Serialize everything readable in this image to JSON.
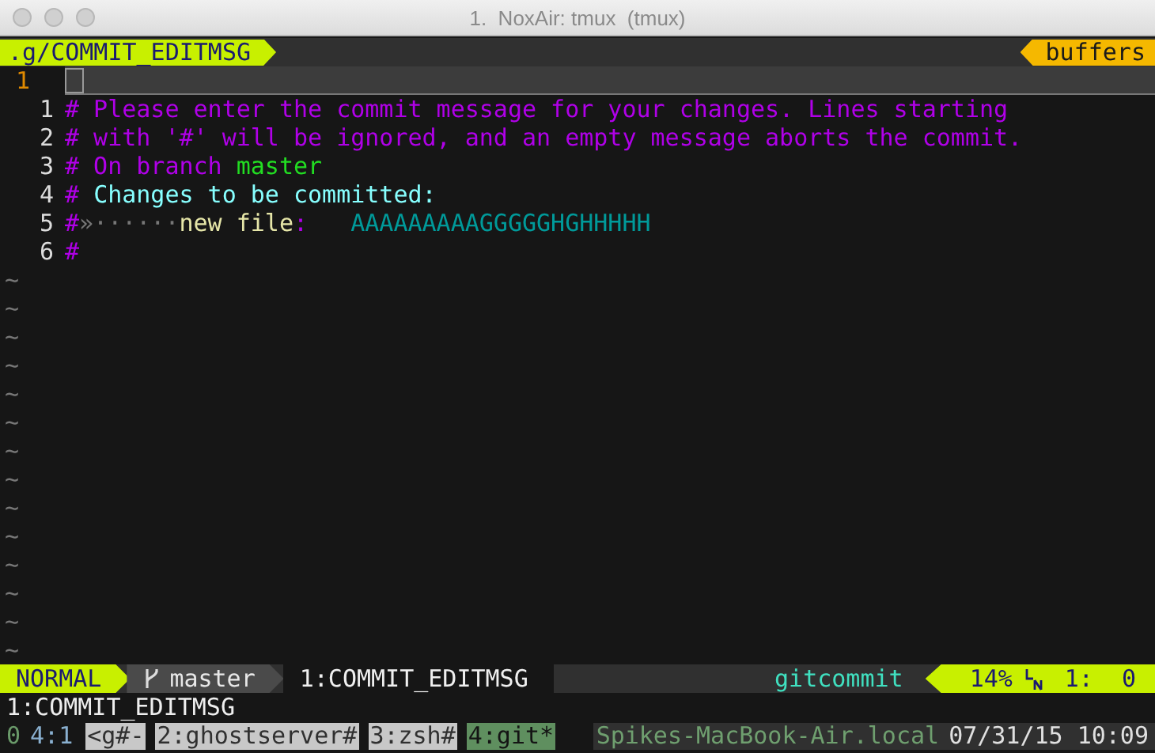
{
  "window": {
    "title": "1.  NoxAir: tmux  (tmux)"
  },
  "tabline": {
    "buffer": ".g/COMMIT_EDITMSG",
    "buffers_label": "buffers"
  },
  "top_pane": {
    "line_number": "1"
  },
  "editor": {
    "lines": [
      {
        "number": "1",
        "segments": [
          {
            "kind": "comment",
            "text": "# Please enter the commit message for your changes. Lines starting"
          }
        ]
      },
      {
        "number": "2",
        "segments": [
          {
            "kind": "comment",
            "text": "# with '#' will be ignored, and an empty message aborts the commit."
          }
        ]
      },
      {
        "number": "3",
        "segments": [
          {
            "kind": "comment",
            "text": "# On branch "
          },
          {
            "kind": "branch",
            "text": "master"
          }
        ]
      },
      {
        "number": "4",
        "segments": [
          {
            "kind": "comment",
            "text": "# "
          },
          {
            "kind": "heading",
            "text": "Changes to be committed:"
          }
        ]
      },
      {
        "number": "5",
        "segments": [
          {
            "kind": "comment",
            "text": "#"
          },
          {
            "kind": "whitespace",
            "text": "»······"
          },
          {
            "kind": "label",
            "text": "new file"
          },
          {
            "kind": "comment",
            "text": ":   "
          },
          {
            "kind": "filename",
            "text": "AAAAAAAAAGGGGGHGHHHHH"
          }
        ]
      },
      {
        "number": "6",
        "segments": [
          {
            "kind": "comment",
            "text": "#"
          }
        ]
      }
    ],
    "empty_line_markers": [
      "~",
      "~",
      "~",
      "~",
      "~",
      "~",
      "~",
      "~",
      "~",
      "~",
      "~",
      "~",
      "~",
      "~"
    ]
  },
  "statusline": {
    "mode": "NORMAL",
    "branch": "master",
    "file": "1:COMMIT_EDITMSG",
    "filetype": "gitcommit",
    "percent": "14%",
    "line": "1:",
    "column": "0"
  },
  "command_line": "1:COMMIT_EDITMSG",
  "tmux": {
    "session": "0",
    "pane": "4:1",
    "windows": [
      {
        "label": "<g#-",
        "selected": false
      },
      {
        "label": "2:ghostserver#",
        "selected": false
      },
      {
        "label": "3:zsh#",
        "selected": false
      },
      {
        "label": "4:git*",
        "selected": true
      }
    ],
    "host": "Spikes-MacBook-Air.local",
    "datetime": "07/31/15 10:09"
  }
}
